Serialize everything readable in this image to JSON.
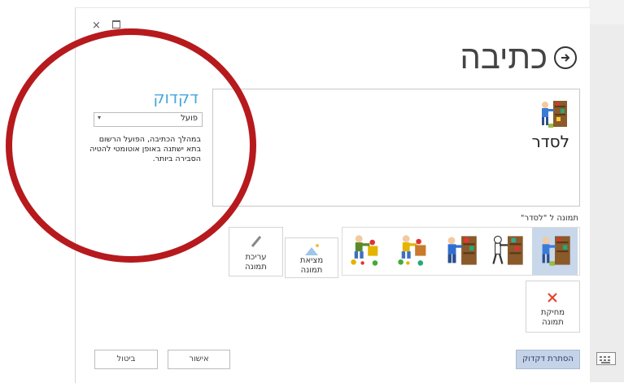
{
  "window": {
    "close_glyph": "×"
  },
  "header": {
    "title": "כתיבה",
    "back_icon": "circle-arrow-right-icon"
  },
  "word": {
    "text": "לסדר",
    "symbol_icon": "person-arranging-shelf-icon"
  },
  "grammar": {
    "title": "דקדוק",
    "select_value": "פועל",
    "description": "במהלך הכתיבה, הפועל הרשום בתא ישתנה באופן אוטומטי להטיה הסבירה ביותר."
  },
  "pictures": {
    "label": "תמונה ל \"לסדר\"",
    "options": [
      {
        "icon": "person-arranging-shelf-icon",
        "selected": true
      },
      {
        "icon": "person-arranging-shelf-icon",
        "selected": false
      },
      {
        "icon": "person-arranging-shelf-icon",
        "selected": false
      },
      {
        "icon": "child-arranging-toys-icon",
        "selected": false
      },
      {
        "icon": "child-arranging-toys-icon",
        "selected": false
      }
    ]
  },
  "tools": {
    "find_picture": "מציאת תמונה",
    "edit_picture": "עריכת תמונה",
    "delete_picture": "מחיקת תמונה"
  },
  "footer": {
    "hide_grammar": "הסתרת דקדוק",
    "ok": "אישור",
    "cancel": "ביטול"
  },
  "colors": {
    "accent": "#49a7dc",
    "annotation": "#b61a1d",
    "selected_bg": "#c8d7ea",
    "delete": "#e4412c"
  }
}
